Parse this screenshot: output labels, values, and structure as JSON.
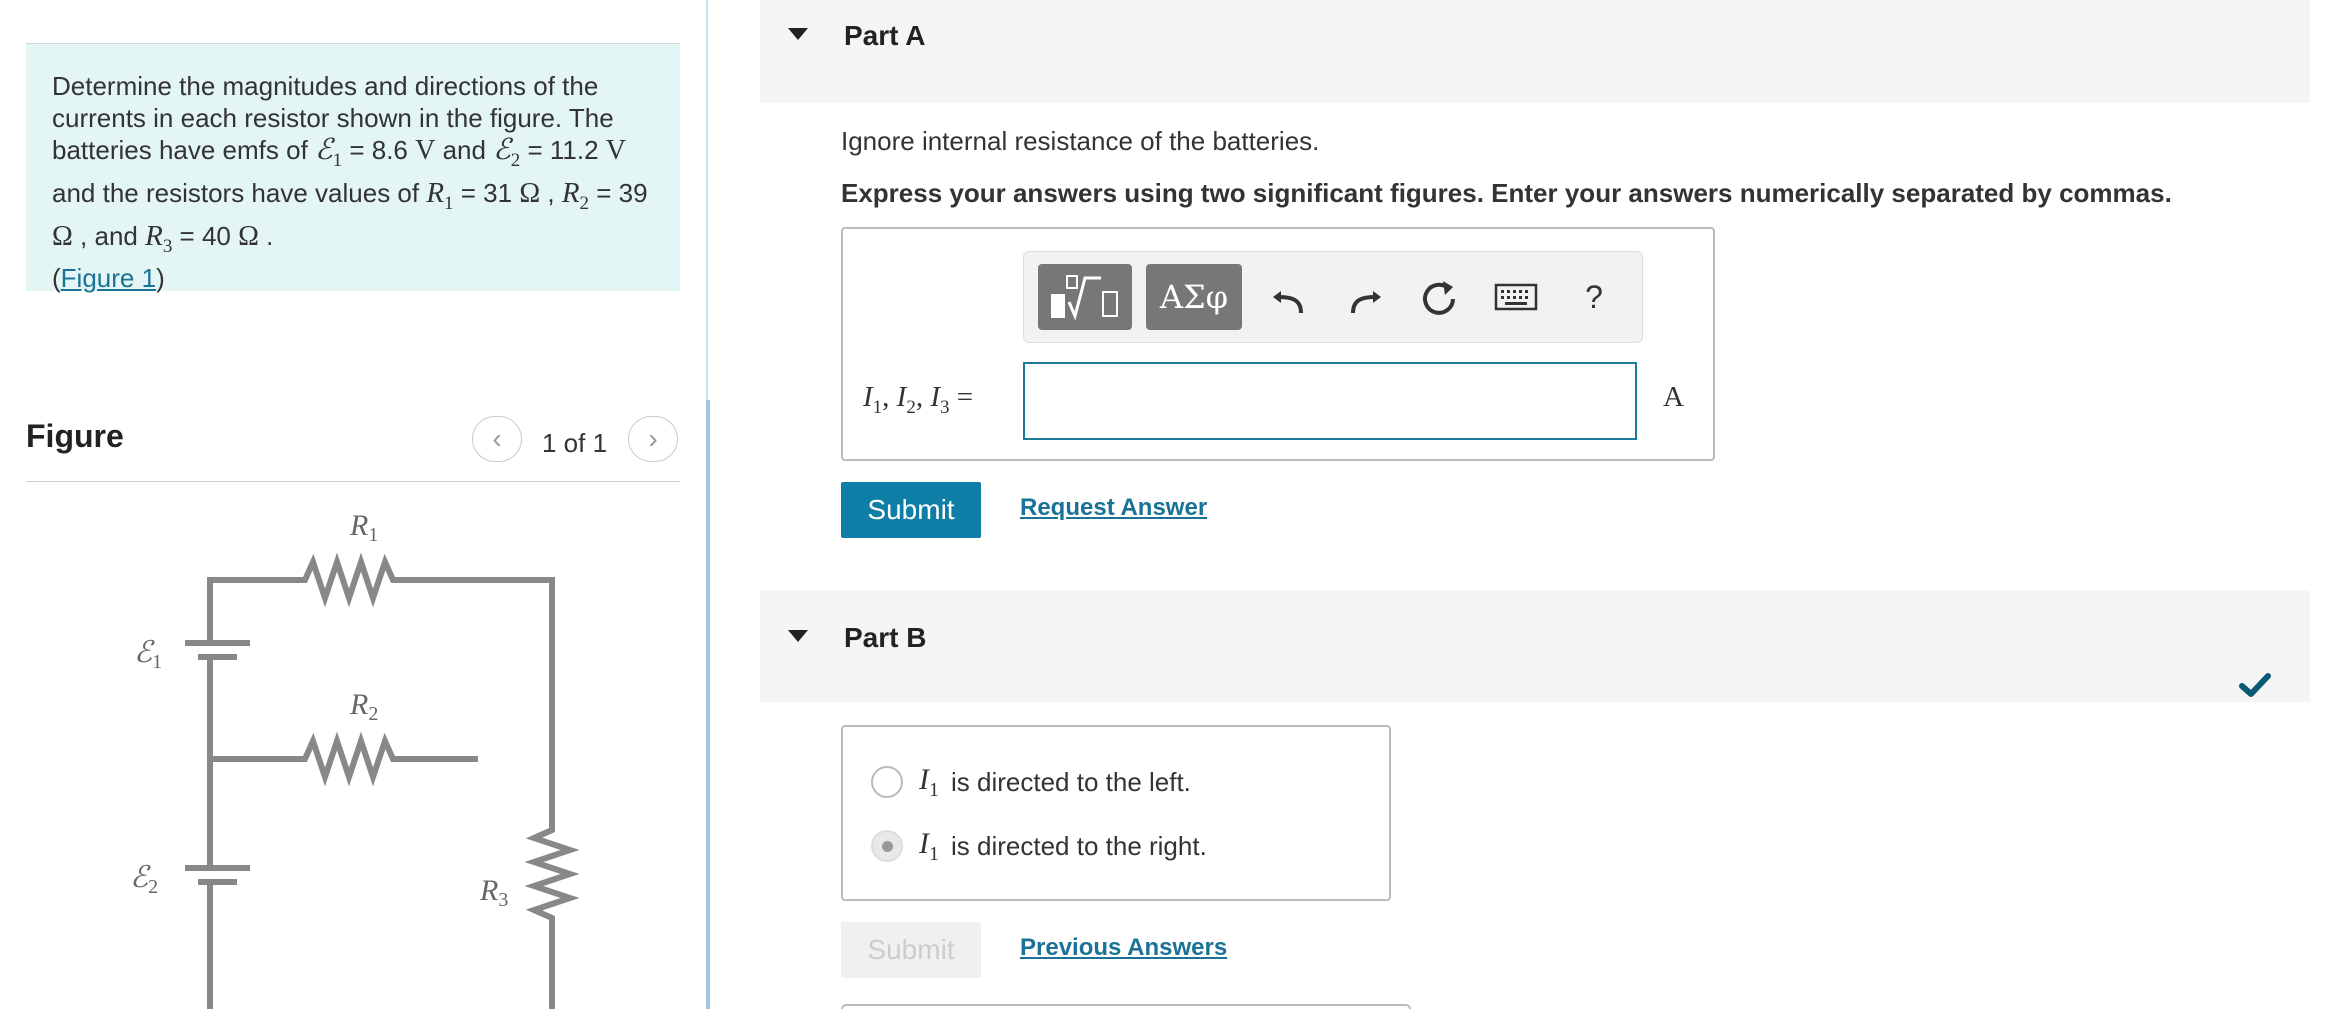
{
  "problem": {
    "t1": "Determine the magnitudes and directions of the currents in each resistor shown in the figure. The batteries have emfs of",
    "emf1_sym": "ℰ",
    "emf1_sub": "1",
    "emf1_val": " = 8.6 ",
    "volt_unit": "V",
    "and1": " and ",
    "emf2_sym": "ℰ",
    "emf2_sub": "2",
    "emf2_val": " = 11.2 ",
    "t2": " and the resistors have values of ",
    "r_sym": "R",
    "r1_sub": "1",
    "r1_val": " = 31 ",
    "ohm": "Ω",
    "comma": " , ",
    "r2_sub": "2",
    "r2_val": " = 39 ",
    "and2": " , and ",
    "r3_sub": "3",
    "r3_val": " = 40 ",
    "period": " .",
    "fig_open": "(",
    "fig_link": "Figure 1",
    "fig_close": ")"
  },
  "figure": {
    "title": "Figure",
    "counter": "1 of 1",
    "prev_glyph": "‹",
    "next_glyph": "›",
    "labels": {
      "r1": "R",
      "r1_sub": "1",
      "r2": "R",
      "r2_sub": "2",
      "r3": "R",
      "r3_sub": "3",
      "e1": "ℰ",
      "e1_sub": "1",
      "e2": "ℰ",
      "e2_sub": "2"
    }
  },
  "partA": {
    "title": "Part A",
    "instruction": "Ignore internal resistance of the batteries.",
    "express": "Express your answers using two significant figures. Enter your answers numerically separated by commas.",
    "var_i": "I",
    "sub1": "1",
    "sub2": "2",
    "sub3": "3",
    "sep": ", ",
    "equals": " =",
    "input_value": "",
    "unit": "A",
    "toolbar": {
      "greek": "ΑΣφ",
      "help": "?",
      "icons": [
        "templates-icon",
        "greek-icon",
        "undo-icon",
        "redo-icon",
        "reset-icon",
        "keyboard-icon",
        "help-icon"
      ]
    },
    "submit": "Submit",
    "request_answer": "Request Answer"
  },
  "partB": {
    "title": "Part B",
    "choices": [
      {
        "sym": "I",
        "sub": "1",
        "text": "is directed to the left.",
        "selected": false
      },
      {
        "sym": "I",
        "sub": "1",
        "text": "is directed to the right.",
        "selected": true
      }
    ],
    "submit": "Submit",
    "previous_answers": "Previous Answers"
  },
  "colors": {
    "accent": "#0e7ea6",
    "link": "#1a7296",
    "problem_bg": "#e3f5f5",
    "check": "#0a5a74"
  }
}
